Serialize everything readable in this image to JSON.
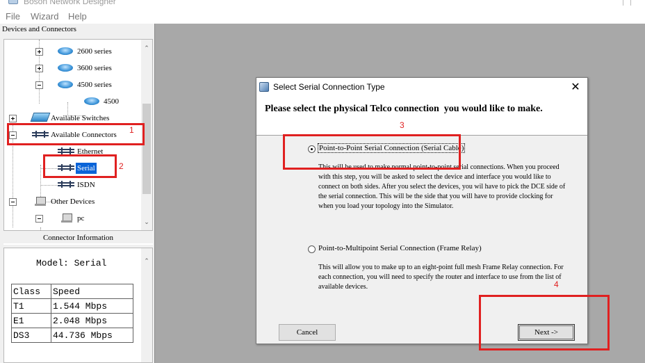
{
  "window": {
    "title": "Boson Network Designer"
  },
  "menu": [
    "File",
    "Wizard",
    "Help"
  ],
  "left_panel": {
    "header": "Devices and Connectors",
    "tree": [
      {
        "label": "2600 series",
        "icon": "router-icon"
      },
      {
        "label": "3600 series",
        "icon": "router-icon"
      },
      {
        "label": "4500 series",
        "icon": "router-icon"
      },
      {
        "label": "4500",
        "icon": "router-icon"
      },
      {
        "label": "Available Switches",
        "icon": "switch-icon"
      },
      {
        "label": "Available Connectors",
        "icon": "connector-icon"
      },
      {
        "label": "Ethernet",
        "icon": "connector-icon"
      },
      {
        "label": "Serial",
        "icon": "connector-icon",
        "selected": true
      },
      {
        "label": "ISDN",
        "icon": "connector-icon"
      },
      {
        "label": "Other Devices",
        "icon": "pc-icon"
      },
      {
        "label": "pc",
        "icon": "pc-icon"
      }
    ],
    "info_header": "Connector Information",
    "model_line": "Model: Serial",
    "speed_table": {
      "headers": [
        "Class",
        "Speed"
      ],
      "rows": [
        [
          "T1",
          "1.544 Mbps"
        ],
        [
          "E1",
          "2.048 Mbps"
        ],
        [
          "DS3",
          "44.736 Mbps"
        ]
      ]
    }
  },
  "dialog": {
    "title": "Select Serial Connection Type",
    "heading": "Please select the physical Telco connection  you would like to make.",
    "options": [
      {
        "label": "Point-to-Point Serial Connection (Serial Cable)",
        "selected": true,
        "description": "This will be used to make normal point-to-point serial connections. When you proceed with this step, you will be asked to select the device and interface you would like to connect on both sides.  After you select the devices, you wil have to pick the DCE side of the serial connection. This will be the side that you will have to provide clocking for when you load your topology into the Simulator."
      },
      {
        "label": "Point-to-Multipoint Serial Connection (Frame Relay)",
        "selected": false,
        "description": "This will allow you to make up to an eight-point full mesh Frame Relay connection. For each connection, you will need to specify the router and interface to use from the list of available devices."
      }
    ],
    "cancel_label": "Cancel",
    "next_label": "Next ->"
  },
  "annotations": [
    "1",
    "2",
    "3",
    "4"
  ],
  "colors": {
    "annotation": "#e02020",
    "selection": "#0a64d8",
    "canvas": "#a8a8a8"
  }
}
